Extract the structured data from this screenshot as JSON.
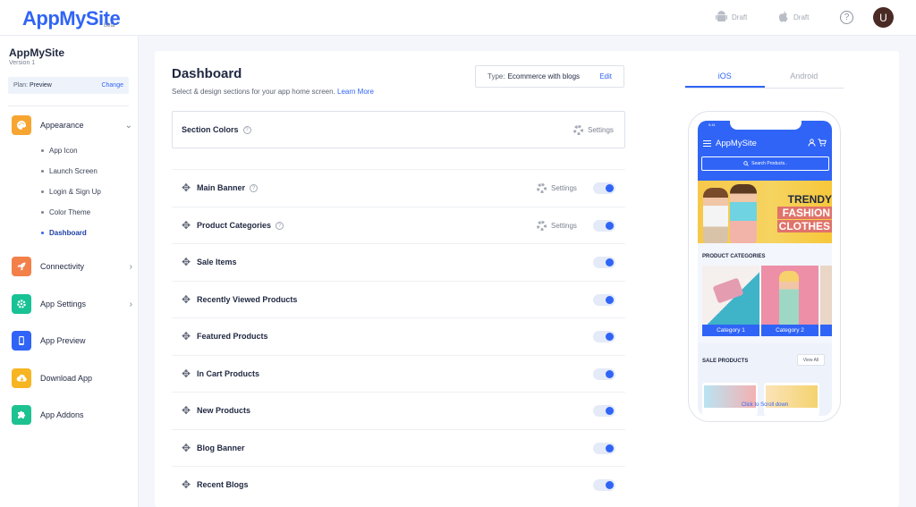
{
  "brand": {
    "logo": "AppMySite",
    "beta": "Beta"
  },
  "topbar": {
    "android_draft": "Draft",
    "ios_draft": "Draft",
    "help": "?",
    "avatar_initial": "U"
  },
  "sidebar": {
    "app_name": "AppMySite",
    "version": "Version 1",
    "plan_label": "Plan:",
    "plan_value": "Preview",
    "plan_change": "Change",
    "items": [
      {
        "label": "Appearance",
        "icon": "palette-icon",
        "color": "#f7a531"
      },
      {
        "label": "Connectivity",
        "icon": "rocket-icon",
        "color": "#f37f49"
      },
      {
        "label": "App Settings",
        "icon": "gear-icon",
        "color": "#18c294"
      },
      {
        "label": "App Preview",
        "icon": "phone-icon",
        "color": "#3064f6"
      },
      {
        "label": "Download App",
        "icon": "cloud-download-icon",
        "color": "#f7b521"
      },
      {
        "label": "App Addons",
        "icon": "puzzle-icon",
        "color": "#1ec290"
      }
    ],
    "appearance_sub": [
      "App Icon",
      "Launch Screen",
      "Login & Sign Up",
      "Color Theme",
      "Dashboard"
    ]
  },
  "dashboard": {
    "title": "Dashboard",
    "subtitle": "Select & design sections for your app home screen.",
    "learn_more": "Learn More",
    "type_label": "Type:",
    "type_value": "Ecommerce with blogs",
    "type_edit": "Edit",
    "section_colors": "Section Colors",
    "settings_label": "Settings",
    "sections": [
      {
        "name": "Main Banner",
        "help": true,
        "settings": true,
        "enabled": true
      },
      {
        "name": "Product Categories",
        "help": true,
        "settings": true,
        "enabled": true
      },
      {
        "name": "Sale Items",
        "enabled": true
      },
      {
        "name": "Recently Viewed Products",
        "enabled": true
      },
      {
        "name": "Featured Products",
        "enabled": true
      },
      {
        "name": "In Cart Products",
        "enabled": true
      },
      {
        "name": "New Products",
        "enabled": true
      },
      {
        "name": "Blog Banner",
        "enabled": true
      },
      {
        "name": "Recent Blogs",
        "enabled": true
      }
    ]
  },
  "preview": {
    "tabs": [
      "iOS",
      "Android"
    ],
    "active_tab": "iOS",
    "status_time": "9:41",
    "app_name": "AppMySite",
    "search_placeholder": "Search Products..",
    "banner": [
      "TRENDY",
      "FASHION",
      "CLOTHES"
    ],
    "categories_title": "PRODUCT CATEGORIES",
    "categories": [
      "Category 1",
      "Category 2"
    ],
    "sale_title": "SALE PRODUCTS",
    "view_all": "View All",
    "scroll_hint": "Click to Scroll down"
  },
  "colors": {
    "accent": "#3064f6",
    "toggle_bg": "#e4eaf8"
  }
}
